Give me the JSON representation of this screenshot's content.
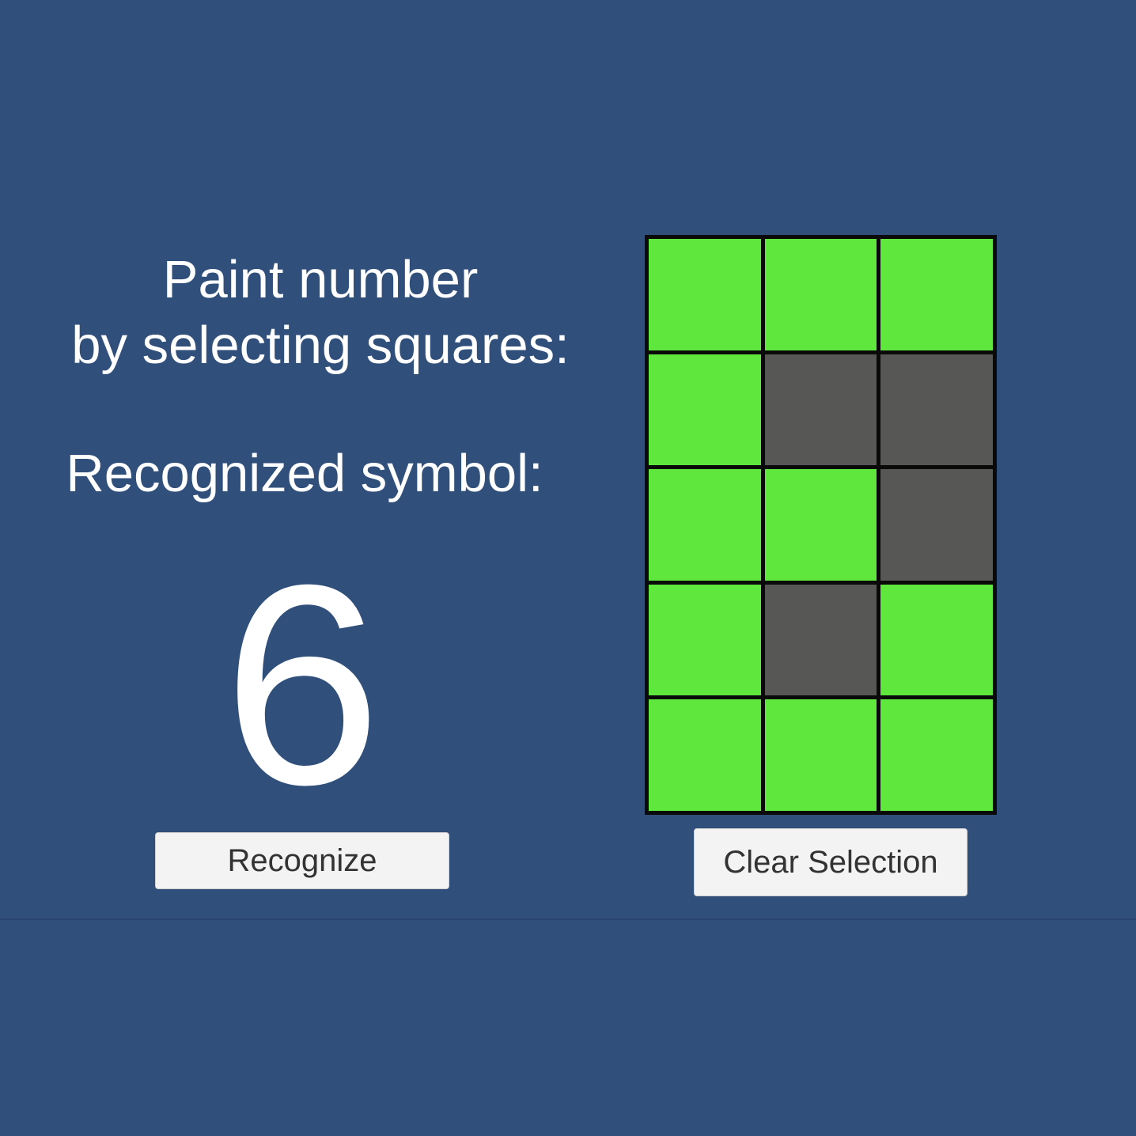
{
  "instructions": {
    "line1": "Paint number",
    "line2": "by selecting squares:"
  },
  "result": {
    "label": "Recognized symbol:",
    "value": "6"
  },
  "buttons": {
    "recognize": "Recognize",
    "clear": "Clear Selection"
  },
  "colors": {
    "background": "#314f7b",
    "selected": "#5fe73d",
    "unselected": "#575755",
    "grid_border": "#0a0a0a"
  },
  "grid": {
    "rows": 5,
    "cols": 3,
    "cells": [
      [
        true,
        true,
        true
      ],
      [
        true,
        false,
        false
      ],
      [
        true,
        true,
        false
      ],
      [
        true,
        false,
        true
      ],
      [
        true,
        true,
        true
      ]
    ]
  }
}
